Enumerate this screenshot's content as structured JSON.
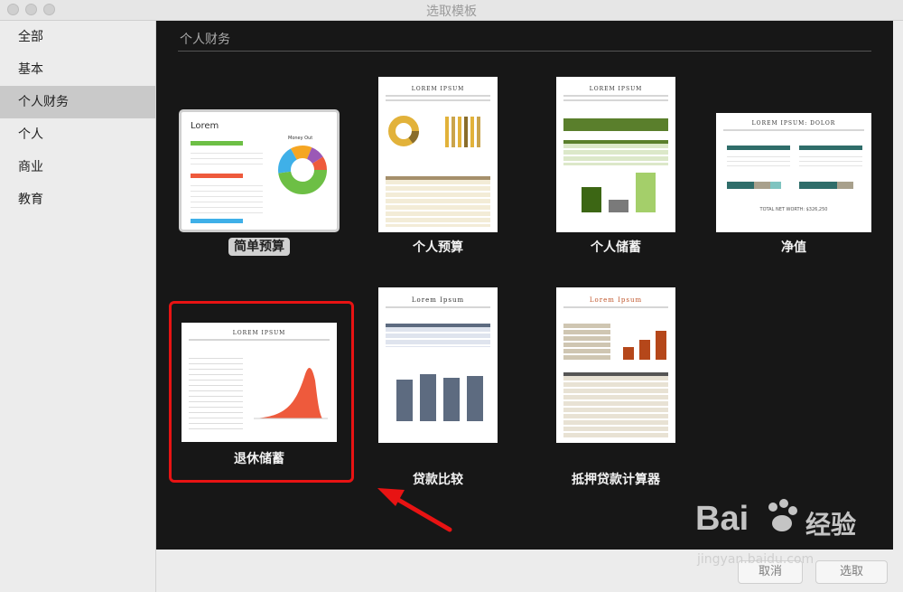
{
  "window": {
    "title": "选取模板"
  },
  "sidebar": {
    "items": [
      {
        "label": "全部"
      },
      {
        "label": "基本"
      },
      {
        "label": "个人财务"
      },
      {
        "label": "个人"
      },
      {
        "label": "商业"
      },
      {
        "label": "教育"
      }
    ],
    "selected": "个人财务"
  },
  "section": {
    "label": "个人财务"
  },
  "templates": [
    {
      "label": "简单预算",
      "preview_title": "Lorem",
      "preview_chart": "Money Out"
    },
    {
      "label": "个人预算",
      "preview_title": "LOREM IPSUM"
    },
    {
      "label": "个人储蓄",
      "preview_title": "LOREM IPSUM"
    },
    {
      "label": "净值",
      "preview_title": "LOREM IPSUM: DOLOR",
      "preview_footer": "TOTAL NET WORTH: $326,250"
    },
    {
      "label": "退休储蓄",
      "preview_title": "LOREM IPSUM"
    },
    {
      "label": "贷款比较",
      "preview_title": "Lorem Ipsum"
    },
    {
      "label": "抵押贷款计算器",
      "preview_title": "Lorem Ipsum"
    }
  ],
  "buttons": {
    "cancel": "取消",
    "choose": "选取"
  },
  "watermark": {
    "brand": "Bai",
    "suffix": "经验",
    "url": "jingyan.baidu.com"
  },
  "colors": {
    "highlight": "#e81313",
    "background": "#171717",
    "selected_sidebar": "#c9c9c9"
  }
}
